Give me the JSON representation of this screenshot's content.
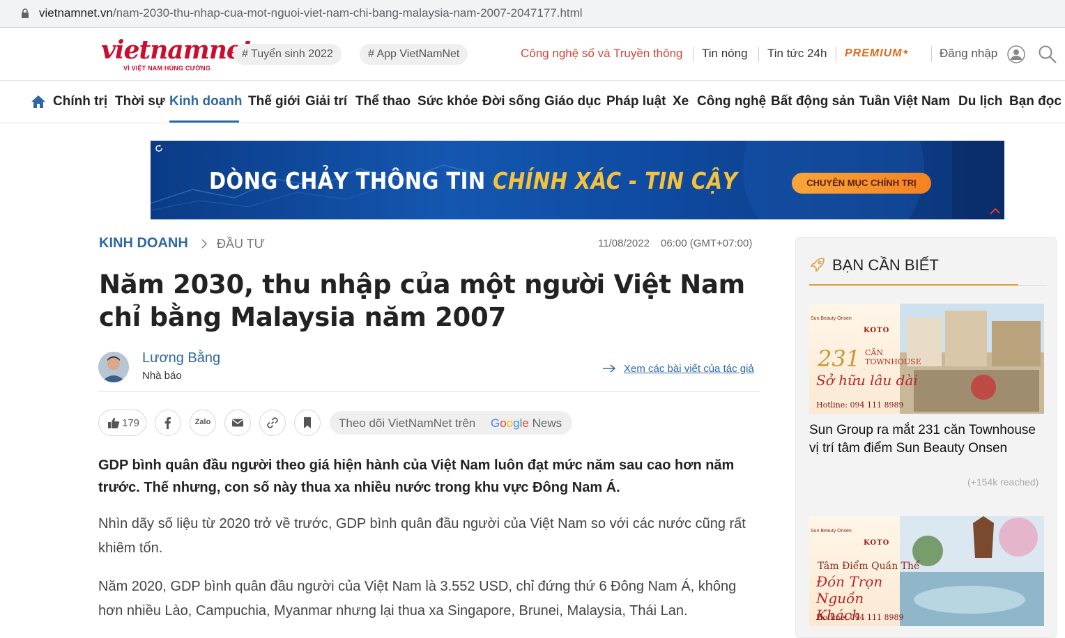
{
  "browser": {
    "url_host": "vietnamnet.vn",
    "url_path": "/nam-2030-thu-nhap-cua-mot-nguoi-viet-nam-chi-bang-malaysia-nam-2007-2047177.html"
  },
  "header": {
    "logo_text": "vietnamnet",
    "logo_tagline": "VÌ VIỆT NAM HÙNG CƯỜNG",
    "tags": [
      "# Tuyển sinh 2022",
      "# App VietNamNet"
    ],
    "links": {
      "tech": "Công nghệ số và Truyền thông",
      "hot": "Tin nóng",
      "news24h": "Tin tức 24h",
      "premium": "PREMIUM",
      "login": "Đăng nhập"
    },
    "colors": {
      "brand_red": "#c8102e",
      "accent_blue": "#2d67a6",
      "premium_orange": "#e06a1b"
    }
  },
  "nav": {
    "items": [
      "Chính trị",
      "Thời sự",
      "Kinh doanh",
      "Thế giới",
      "Giải trí",
      "Thể thao",
      "Sức khỏe",
      "Đời sống",
      "Giáo dục",
      "Pháp luật",
      "Xe",
      "Công nghệ",
      "Bất động sản",
      "Tuần Việt Nam",
      "Du lịch",
      "Bạn đọc"
    ],
    "active": "Kinh doanh"
  },
  "banner": {
    "text_main": "DÒNG CHẢY THÔNG TIN ",
    "text_highlight": "CHÍNH XÁC - TIN CẬY",
    "button": "CHUYÊN MỤC CHÍNH TRỊ"
  },
  "article": {
    "category": "KINH DOANH",
    "subcategory": "ĐẦU TƯ",
    "date": "11/08/2022",
    "time": "06:00 (GMT+07:00)",
    "title": "Năm 2030, thu nhập của một người Việt Nam chỉ bằng Malaysia năm 2007",
    "author": {
      "name": "Lương Bằng",
      "role": "Nhà báo",
      "link": "Xem các bài viết của tác giả"
    },
    "likes": "179",
    "zalo_label": "Zalo",
    "google_news": {
      "prefix": "Theo dõi VietNamNet trên",
      "brand": "Google",
      "suffix": "News"
    },
    "lead": "GDP bình quân đầu người theo giá hiện hành của Việt Nam luôn đạt mức năm sau cao hơn năm trước. Thế nhưng, con số này thua xa nhiều nước trong khu vực Đông Nam Á.",
    "paragraphs": [
      "Nhìn dãy số liệu từ 2020 trở về trước, GDP bình quân đầu người của Việt Nam so với các nước cũng rất khiêm tốn.",
      "Năm 2020, GDP bình quân đầu người của Việt Nam là 3.552 USD, chỉ đứng thứ 6 Đông Nam Á, không hơn nhiều Lào, Campuchia, Myanmar nhưng lại thua xa Singapore, Brunei, Malaysia, Thái Lan."
    ]
  },
  "sidebar": {
    "title": "BẠN CẦN BIẾT",
    "ads": [
      {
        "brand": "Sun Beauty Onsen",
        "partner": "KOTO",
        "headline_number": "231",
        "headline_small": "CĂN TOWNHOUSE",
        "script": "Sở hữu lâu dài",
        "hotline": "Hotline: 094 111 8989",
        "title": "Sun Group ra mắt 231 căn Townhouse vị trí tâm điểm Sun Beauty Onsen",
        "reach": "(+154k reached)"
      },
      {
        "brand": "Sun Beauty Onsen",
        "partner": "KOTO",
        "line1": "Tâm Điểm Quần Thể",
        "script": "Đón Trọn Nguồn Khách",
        "hotline": "Hotline: 094 111 8989"
      }
    ]
  }
}
